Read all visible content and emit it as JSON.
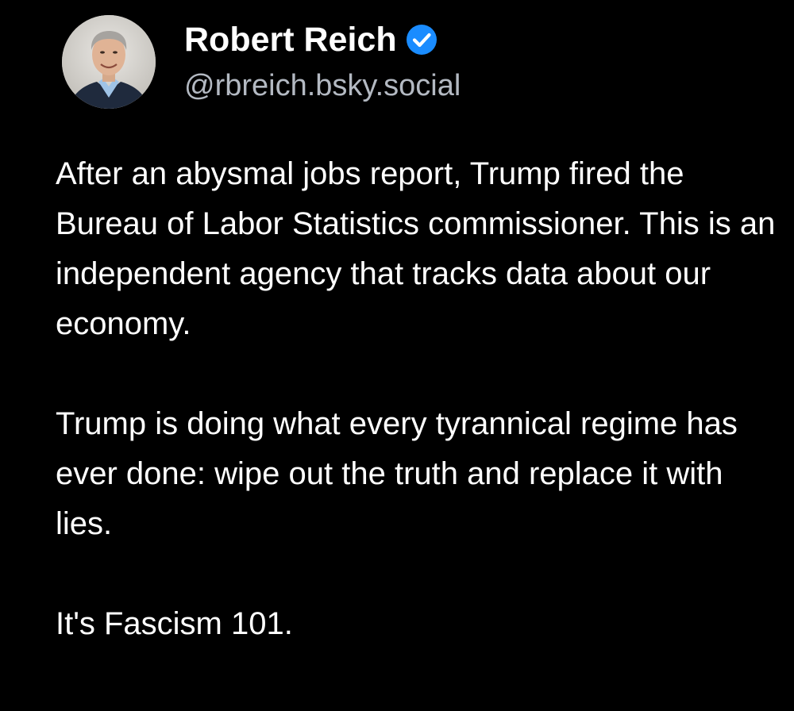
{
  "post": {
    "author": {
      "name": "Robert Reich",
      "handle": "@rbreich.bsky.social",
      "verified": true,
      "verified_color": "#1a8cff"
    },
    "paragraphs": [
      "After an abysmal jobs report, Trump fired the Bureau of Labor Statistics commissioner. This is an independent agency that tracks data about our economy.",
      "Trump is doing what every tyrannical regime has ever done: wipe out the truth and replace it with lies.",
      "It's Fascism 101."
    ]
  },
  "colors": {
    "background": "#000000",
    "text": "#ffffff",
    "handle": "#b3b9c2"
  }
}
